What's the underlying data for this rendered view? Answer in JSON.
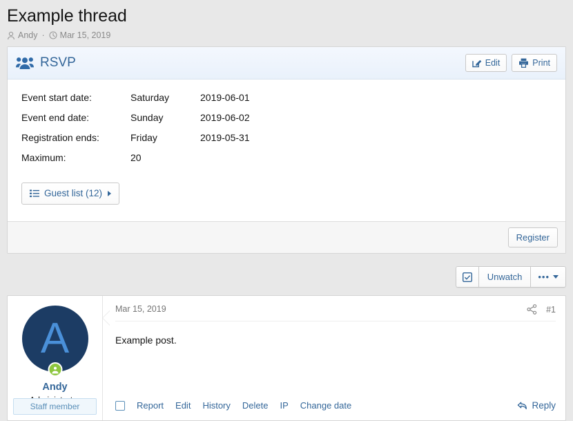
{
  "thread": {
    "title": "Example thread",
    "author": "Andy",
    "separator": "·",
    "date": "Mar 15, 2019"
  },
  "rsvp": {
    "title": "RSVP",
    "edit_label": "Edit",
    "print_label": "Print",
    "details": [
      {
        "label": "Event start date:",
        "day": "Saturday",
        "date": "2019-06-01"
      },
      {
        "label": "Event end date:",
        "day": "Sunday",
        "date": "2019-06-02"
      },
      {
        "label": "Registration ends:",
        "day": "Friday",
        "date": "2019-05-31"
      },
      {
        "label": "Maximum:",
        "day": "20",
        "date": ""
      }
    ],
    "guest_list_label": "Guest list (12)",
    "register_label": "Register"
  },
  "toolbar": {
    "watch_label": "Unwatch",
    "more_label": "•••"
  },
  "post": {
    "date": "Mar 15, 2019",
    "number": "#1",
    "message": "Example post.",
    "author": {
      "initial": "A",
      "name": "Andy",
      "title": "Administrator",
      "banner": "Staff member"
    },
    "actions": [
      "Report",
      "Edit",
      "History",
      "Delete",
      "IP",
      "Change date"
    ],
    "reply_label": "Reply"
  },
  "colors": {
    "accent": "#336699",
    "avatar_bg": "#1c3c64",
    "avatar_fg": "#4a90d9",
    "online": "#8dc63f",
    "page_bg": "#e8e8e8"
  }
}
